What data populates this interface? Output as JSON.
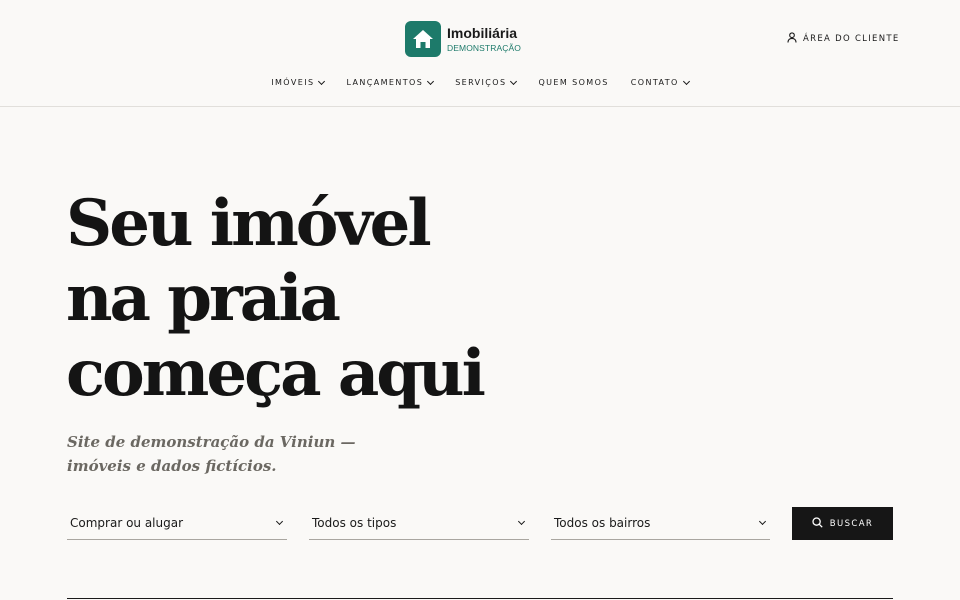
{
  "brand": {
    "name": "Imobiliária",
    "subtitle": "DEMONSTRAÇÃO",
    "color": "#1d7a6a",
    "icon": "house-icon"
  },
  "header": {
    "client_area_label": "ÁREA DO CLIENTE",
    "client_icon": "user-icon"
  },
  "nav": {
    "items": [
      {
        "label": "IMÓVEIS",
        "dropdown": true
      },
      {
        "label": "LANÇAMENTOS",
        "dropdown": true
      },
      {
        "label": "SERVIÇOS",
        "dropdown": true
      },
      {
        "label": "QUEM SOMOS",
        "dropdown": false
      },
      {
        "label": "CONTATO",
        "dropdown": true
      }
    ]
  },
  "hero": {
    "title_lines": [
      "Seu imóvel",
      "na praia",
      "começa aqui"
    ],
    "subtitle": "Site de demonstração da Viniun — imóveis e dados fictícios."
  },
  "search": {
    "purpose": "Comprar ou alugar",
    "type": "Todos os tipos",
    "neighborhood": "Todos os bairros",
    "button_label": "BUSCAR",
    "button_icon": "search-icon"
  }
}
